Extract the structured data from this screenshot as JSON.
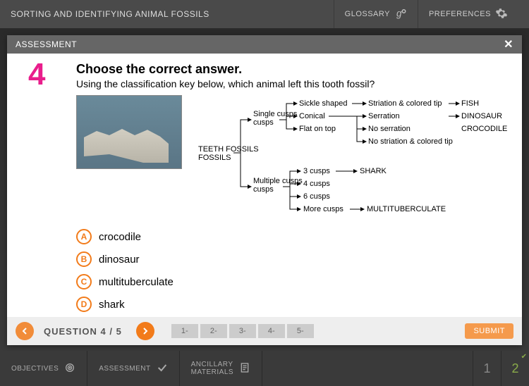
{
  "topbar": {
    "title": "SORTING AND IDENTIFYING ANIMAL FOSSILS",
    "glossary": "GLOSSARY",
    "preferences": "PREFERENCES"
  },
  "panel": {
    "header": "ASSESSMENT",
    "question_number": "4",
    "title": "Choose the correct answer.",
    "subtitle": "Using the classification key below, which animal left this tooth fossil?",
    "key": {
      "root": "TEETH FOSSILS",
      "branch1": "Single cusps",
      "branch2": "Multiple cusps",
      "s1": "Sickle shaped",
      "s2": "Conical",
      "s3": "Flat on top",
      "c1": "Striation & colored tip",
      "c2": "Serration",
      "c3": "No serration",
      "c4": "No striation & colored tip",
      "r1": "FISH",
      "r2": "DINOSAUR",
      "r3": "CROCODILE",
      "m1": "3 cusps",
      "m2": "4 cusps",
      "m3": "6 cusps",
      "m4": "More cusps",
      "mr1": "SHARK",
      "mr2": "MULTITUBERCULATE"
    },
    "answers": [
      {
        "letter": "A",
        "text": "crocodile"
      },
      {
        "letter": "B",
        "text": "dinosaur"
      },
      {
        "letter": "C",
        "text": "multituberculate"
      },
      {
        "letter": "D",
        "text": "shark"
      }
    ],
    "footer": {
      "counter": "QUESTION 4 / 5",
      "boxes": [
        "1-",
        "2-",
        "3-",
        "4-",
        "5-"
      ],
      "submit": "SUBMIT"
    }
  },
  "bottombar": {
    "objectives": "OBJECTIVES",
    "assessment": "ASSESSMENT",
    "ancillary1": "ANCILLARY",
    "ancillary2": "MATERIALS",
    "page1": "1",
    "page2": "2"
  }
}
